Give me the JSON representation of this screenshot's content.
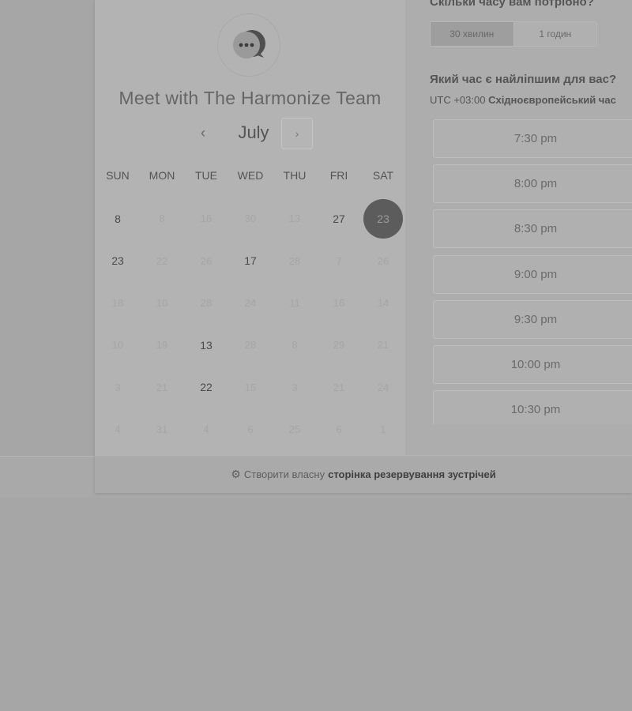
{
  "calendar": {
    "title": "Meet with The Harmonize Team",
    "month": "July",
    "prev_icon": "‹",
    "next_icon": "›",
    "weekdays": [
      "SUN",
      "MON",
      "TUE",
      "WED",
      "THU",
      "FRI",
      "SAT"
    ],
    "weeks": [
      [
        {
          "d": "8",
          "s": "active"
        },
        {
          "d": "8",
          "s": "inactive"
        },
        {
          "d": "16",
          "s": "inactive"
        },
        {
          "d": "30",
          "s": "inactive"
        },
        {
          "d": "13",
          "s": "inactive"
        },
        {
          "d": "27",
          "s": "active"
        },
        {
          "d": "23",
          "s": "selected"
        }
      ],
      [
        {
          "d": "23",
          "s": "active"
        },
        {
          "d": "22",
          "s": "inactive"
        },
        {
          "d": "26",
          "s": "inactive"
        },
        {
          "d": "17",
          "s": "active"
        },
        {
          "d": "28",
          "s": "inactive"
        },
        {
          "d": "7",
          "s": "inactive"
        },
        {
          "d": "26",
          "s": "inactive"
        }
      ],
      [
        {
          "d": "18",
          "s": "inactive"
        },
        {
          "d": "10",
          "s": "inactive"
        },
        {
          "d": "28",
          "s": "inactive"
        },
        {
          "d": "24",
          "s": "inactive"
        },
        {
          "d": "11",
          "s": "inactive"
        },
        {
          "d": "16",
          "s": "inactive"
        },
        {
          "d": "14",
          "s": "inactive"
        }
      ],
      [
        {
          "d": "10",
          "s": "inactive"
        },
        {
          "d": "19",
          "s": "inactive"
        },
        {
          "d": "13",
          "s": "active"
        },
        {
          "d": "28",
          "s": "inactive"
        },
        {
          "d": "8",
          "s": "inactive"
        },
        {
          "d": "29",
          "s": "inactive"
        },
        {
          "d": "21",
          "s": "inactive"
        }
      ],
      [
        {
          "d": "3",
          "s": "inactive"
        },
        {
          "d": "21",
          "s": "inactive"
        },
        {
          "d": "22",
          "s": "active"
        },
        {
          "d": "15",
          "s": "inactive"
        },
        {
          "d": "3",
          "s": "inactive"
        },
        {
          "d": "21",
          "s": "inactive"
        },
        {
          "d": "24",
          "s": "inactive"
        }
      ],
      [
        {
          "d": "4",
          "s": "inactive"
        },
        {
          "d": "31",
          "s": "inactive"
        },
        {
          "d": "4",
          "s": "inactive"
        },
        {
          "d": "6",
          "s": "inactive"
        },
        {
          "d": "25",
          "s": "inactive"
        },
        {
          "d": "6",
          "s": "inactive"
        },
        {
          "d": "1",
          "s": "inactive"
        }
      ]
    ]
  },
  "booking": {
    "duration_question": "Скільки часу вам потрібно?",
    "durations": [
      "30 хвилин",
      "1 годин"
    ],
    "selected_duration": "30 хвилин",
    "time_question": "Який час є найліпшим для вас?",
    "timezone_offset": "UTC +03:00",
    "timezone_name": "Східноєвропейський час",
    "slots": [
      "7:30 pm",
      "8:00 pm",
      "8:30 pm",
      "9:00 pm",
      "9:30 pm",
      "10:00 pm",
      "10:30 pm"
    ]
  },
  "footer": {
    "prefix": "Створити власну",
    "link": "сторінка резервування зустрічей"
  },
  "colors": {
    "selected_day_bg": "#5c5c5c",
    "overlay_bg": "#a6a6a6"
  }
}
